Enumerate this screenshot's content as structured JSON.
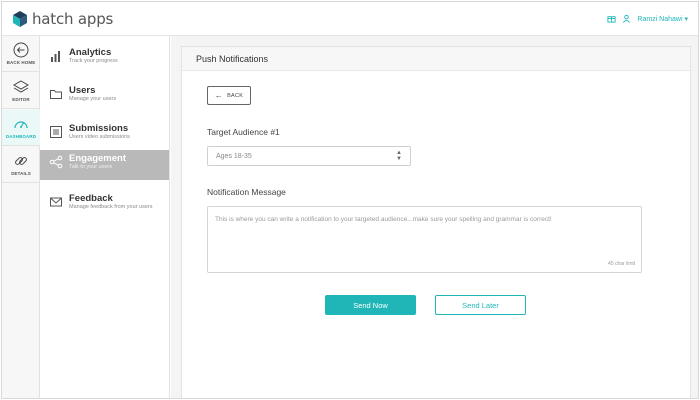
{
  "app": {
    "name": "hatch apps"
  },
  "header": {
    "user_name": "Ramzi Nahawi ▾"
  },
  "rail": {
    "items": [
      {
        "label": "BACK HOME",
        "icon": "back-circle-icon"
      },
      {
        "label": "EDITOR",
        "icon": "layers-icon"
      },
      {
        "label": "DASHBOARD",
        "icon": "gauge-icon"
      },
      {
        "label": "DETAILS",
        "icon": "link-icon"
      }
    ]
  },
  "menu": {
    "items": [
      {
        "title": "Analytics",
        "subtitle": "Track your progress",
        "icon": "bar-chart-icon"
      },
      {
        "title": "Users",
        "subtitle": "Manage your users",
        "icon": "folder-icon"
      },
      {
        "title": "Submissions",
        "subtitle": "Users video submissions",
        "icon": "list-icon"
      },
      {
        "title": "Engagement",
        "subtitle": "Talk to your users",
        "icon": "share-icon"
      },
      {
        "title": "Feedback",
        "subtitle": "Manage feedback from your users",
        "icon": "envelope-icon"
      }
    ],
    "active_index": 3
  },
  "main": {
    "title": "Push Notifications",
    "back_label": "BACK",
    "audience_label": "Target Audience #1",
    "audience_value": "Ages 18-35",
    "message_label": "Notification Message",
    "message_placeholder": "This is where you can write a notification to your targeted audience...make sure your spelling and grammar is correct!",
    "char_limit": "45 char limit",
    "send_now": "Send Now",
    "send_later": "Send Later"
  },
  "colors": {
    "accent": "#20b6b8",
    "active_menu": "#b9b9b9"
  }
}
